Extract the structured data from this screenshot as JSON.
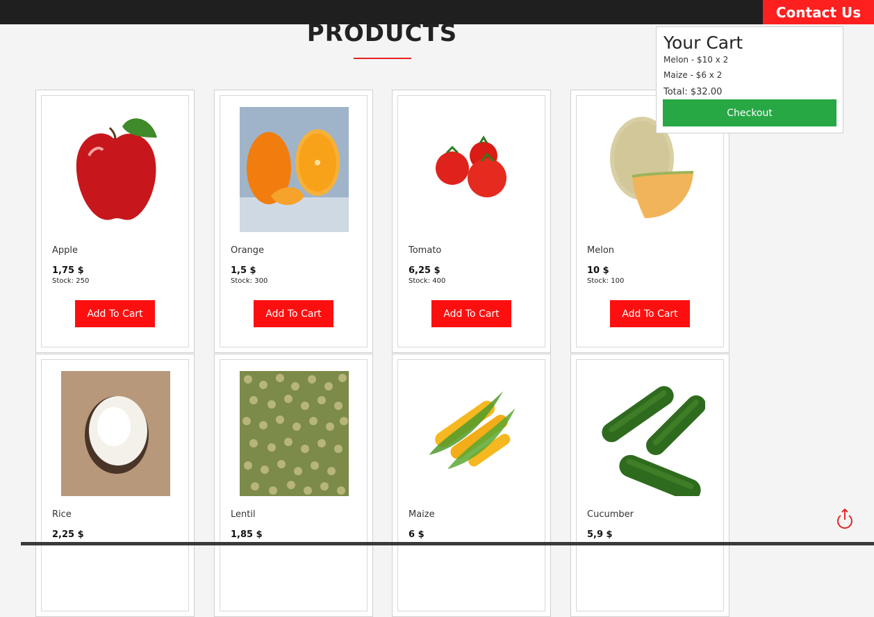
{
  "header": {
    "contact_label": "Contact Us"
  },
  "section": {
    "title": "PRODUCTS"
  },
  "products": [
    {
      "name": "Apple",
      "price": "1,75 $",
      "stock": "Stock: 250",
      "button": "Add To Cart",
      "icon": "apple-icon"
    },
    {
      "name": "Orange",
      "price": "1,5 $",
      "stock": "Stock: 300",
      "button": "Add To Cart",
      "icon": "orange-icon"
    },
    {
      "name": "Tomato",
      "price": "6,25 $",
      "stock": "Stock: 400",
      "button": "Add To Cart",
      "icon": "tomato-icon"
    },
    {
      "name": "Melon",
      "price": "10 $",
      "stock": "Stock: 100",
      "button": "Add To Cart",
      "icon": "melon-icon"
    },
    {
      "name": "Rice",
      "price": "2,25 $",
      "icon": "rice-icon"
    },
    {
      "name": "Lentil",
      "price": "1,85 $",
      "icon": "lentil-icon"
    },
    {
      "name": "Maize",
      "price": "6 $",
      "icon": "maize-icon"
    },
    {
      "name": "Cucumber",
      "price": "5,9 $",
      "icon": "cucumber-icon"
    }
  ],
  "cart": {
    "title": "Your Cart",
    "items": [
      {
        "label": "Melon - $10 x 2"
      },
      {
        "label": "Maize - $6 x 2"
      }
    ],
    "total": "Total: $32.00",
    "checkout_label": "Checkout"
  },
  "colors": {
    "accent_red": "#fe0f0f",
    "checkout_green": "#28a745",
    "topbar": "#1f1f1f"
  }
}
